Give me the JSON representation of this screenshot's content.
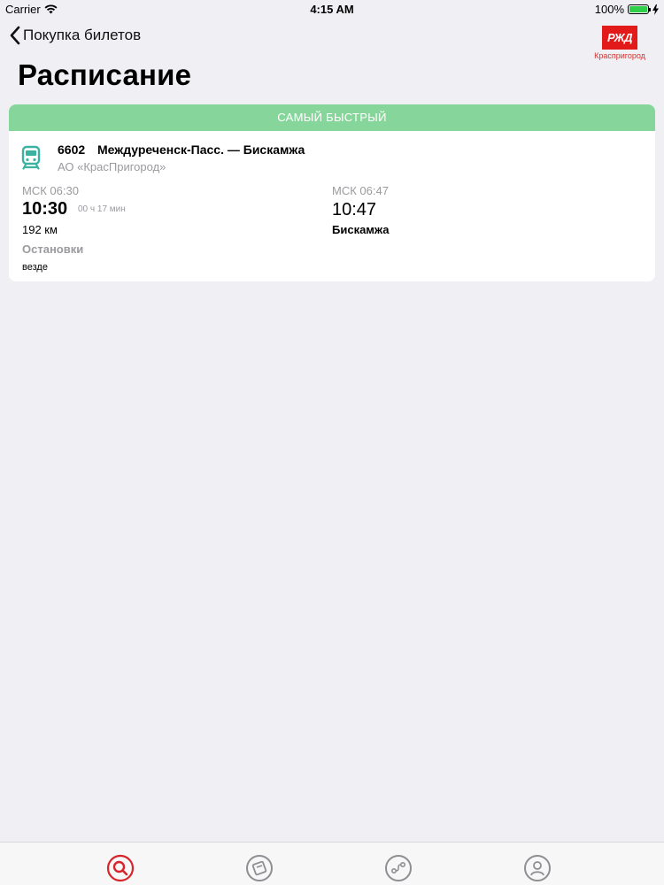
{
  "status_bar": {
    "carrier": "Carrier",
    "time": "4:15 AM",
    "battery": "100%"
  },
  "nav": {
    "back_label": "Покупка билетов",
    "logo_text": "РЖД",
    "logo_caption": "Краспригород"
  },
  "page": {
    "title": "Расписание"
  },
  "card": {
    "banner": "САМЫЙ БЫСТРЫЙ",
    "train_number": "6602",
    "route": "Междуреченск-Пасс. — Бискамжа",
    "carrier": "АО «КрасПригород»",
    "departure": {
      "msk": "МСК 06:30",
      "time": "10:30",
      "duration": "00 ч 17 мин",
      "distance": "192 км"
    },
    "stops_label": "Остановки",
    "stops_value": "везде",
    "arrival": {
      "msk": "МСК 06:47",
      "time": "10:47",
      "station": "Бискамжа"
    }
  },
  "colors": {
    "accent": "#d6262c",
    "banner": "#86d69b",
    "train_icon": "#3bb3a0"
  },
  "tab_bar": {
    "items": [
      {
        "icon": "search-icon",
        "active": true
      },
      {
        "icon": "tickets-icon",
        "active": false
      },
      {
        "icon": "route-icon",
        "active": false
      },
      {
        "icon": "profile-icon",
        "active": false
      }
    ]
  }
}
